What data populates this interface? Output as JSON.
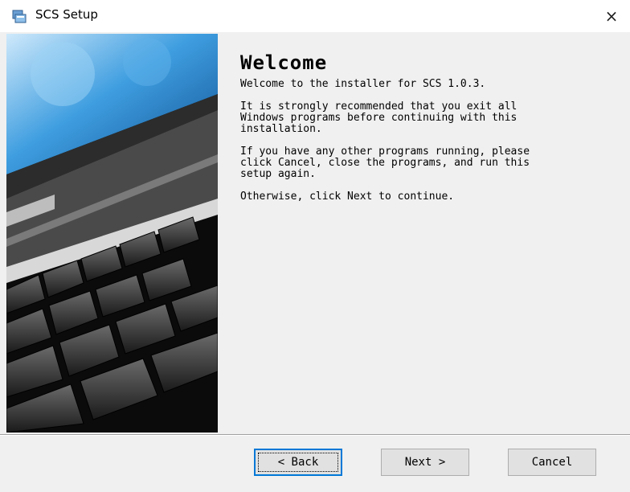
{
  "window": {
    "title": "SCS Setup",
    "close_glyph": "×",
    "icon": "installer-icon"
  },
  "content": {
    "heading": "Welcome",
    "paragraphs": [
      "Welcome to the installer for SCS 1.0.3.",
      "It is strongly recommended that you exit all\nWindows programs before continuing with this\ninstallation.",
      "If you have any other programs running, please\nclick Cancel, close the programs, and run this\nsetup again.",
      "Otherwise, click Next to continue."
    ]
  },
  "buttons": {
    "back": "< Back",
    "next": "Next >",
    "cancel": "Cancel"
  },
  "colors": {
    "background": "#f0f0f0",
    "focus_border": "#0078d7",
    "button_face": "#e1e1e1"
  }
}
